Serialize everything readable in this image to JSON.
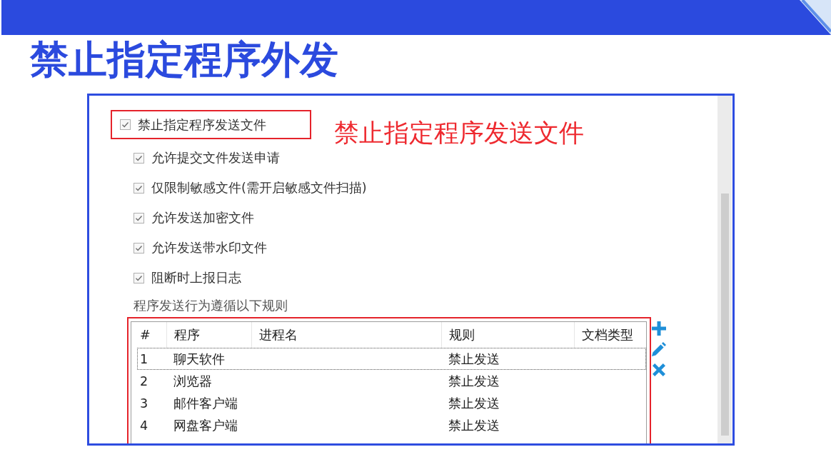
{
  "slide_title": "禁止指定程序外发",
  "settings_screenshot": {
    "options": [
      {
        "label": "禁止指定程序发送文件",
        "checked": true,
        "highlighted": true,
        "children": [
          {
            "label": "允许提交文件发送申请",
            "checked": true
          },
          {
            "label": "仅限制敏感文件(需开启敏感文件扫描)",
            "checked": true
          },
          {
            "label": "允许发送加密文件",
            "checked": true
          },
          {
            "label": "允许发送带水印文件",
            "checked": true
          },
          {
            "label": "阻断时上报日志",
            "checked": true
          }
        ]
      }
    ],
    "annotation": "禁止指定程序发送文件",
    "rules_caption": "程序发送行为遵循以下规则",
    "rules_table": {
      "highlighted": true,
      "columns": [
        "#",
        "程序",
        "进程名",
        "规则",
        "文档类型"
      ],
      "rows": [
        {
          "number": "1",
          "program": "聊天软件",
          "rule": "禁止发送",
          "selected": true
        },
        {
          "number": "2",
          "program": "浏览器",
          "rule": "禁止发送",
          "selected": false
        },
        {
          "number": "3",
          "program": "邮件客户端",
          "rule": "禁止发送",
          "selected": false
        },
        {
          "number": "4",
          "program": "网盘客户端",
          "rule": "禁止发送",
          "selected": false
        }
      ]
    }
  }
}
